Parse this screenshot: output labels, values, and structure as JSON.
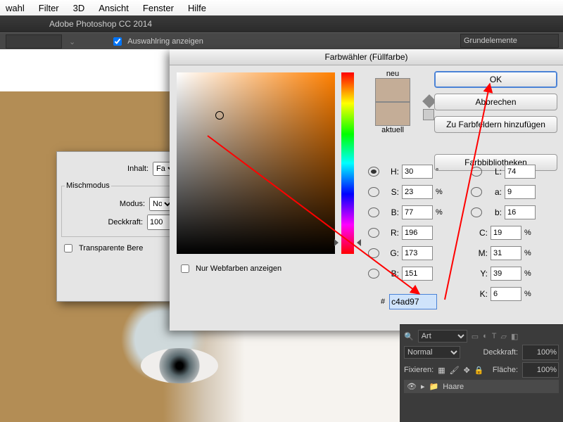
{
  "menu": {
    "items": [
      "wahl",
      "Filter",
      "3D",
      "Ansicht",
      "Fenster",
      "Hilfe"
    ]
  },
  "app_title": "Adobe Photoshop CC 2014",
  "optionsbar": {
    "toggle_label": "Auswahlring anzeigen",
    "right_dropdown": "Grundelemente"
  },
  "fill_dialog": {
    "content_label": "Inhalt:",
    "content_value": "Fa",
    "mix_group": "Mischmodus",
    "mode_label": "Modus:",
    "mode_value": "No",
    "opacity_label": "Deckkraft:",
    "opacity_value": "100",
    "transparent_label": "Transparente Bere"
  },
  "picker": {
    "title": "Farbwähler (Füllfarbe)",
    "new_label": "neu",
    "current_label": "aktuell",
    "new_color": "#c4ad97",
    "current_color": "#c4ad97",
    "buttons": {
      "ok": "OK",
      "cancel": "Abbrechen",
      "add": "Zu Farbfeldern hinzufügen",
      "libs": "Farbbibliotheken"
    },
    "web_only_label": "Nur Webfarben anzeigen",
    "hsb": {
      "H": "30",
      "S": "23",
      "B": "77",
      "H_unit": "°",
      "SB_unit": "%"
    },
    "rgb": {
      "R": "196",
      "G": "173",
      "B": "151"
    },
    "lab": {
      "L": "74",
      "a": "9",
      "b": "16"
    },
    "cmyk": {
      "C": "19",
      "M": "31",
      "Y": "39",
      "K": "6",
      "unit": "%"
    },
    "hex_prefix": "#",
    "hex": "c4ad97"
  },
  "panels": {
    "search": "Art",
    "blend": "Normal",
    "opacity_label": "Deckkraft:",
    "opacity": "100%",
    "lock_label": "Fixieren:",
    "fill_label": "Fläche:",
    "fill": "100%",
    "group_name": "Haare"
  }
}
